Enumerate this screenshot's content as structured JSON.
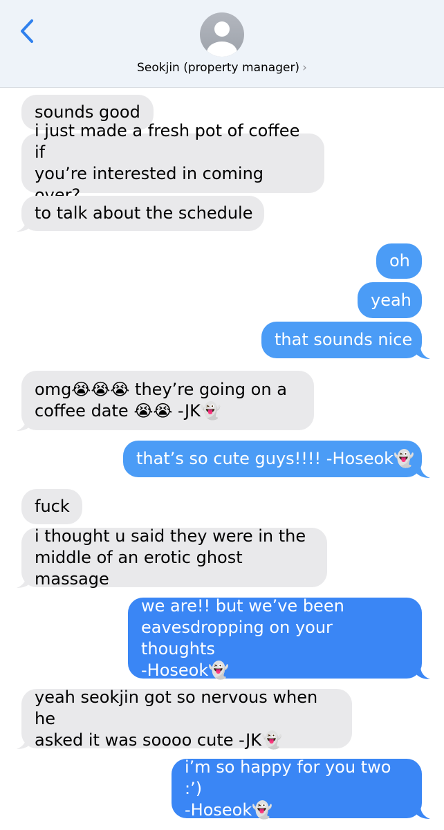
{
  "contact": {
    "name": "Seokjin (property manager)",
    "chevron": "›"
  },
  "messages": [
    {
      "side": "in",
      "text": "sounds good"
    },
    {
      "side": "in",
      "text": "i just made a fresh pot of coffee if\nyou’re interested in coming over?"
    },
    {
      "side": "in",
      "text": "to talk about the schedule"
    },
    {
      "side": "out",
      "text": "oh"
    },
    {
      "side": "out",
      "text": "yeah"
    },
    {
      "side": "out",
      "text": "that sounds nice"
    },
    {
      "side": "in",
      "text": "omg😭😭😭 they’re going on a\ncoffee date 😭😭 -JK👻"
    },
    {
      "side": "out",
      "text": "that’s so cute guys!!!! -Hoseok👻"
    },
    {
      "side": "in",
      "text": "fuck"
    },
    {
      "side": "in",
      "text": "i thought u said they were in the\nmiddle of an erotic ghost massage"
    },
    {
      "side": "out",
      "text": "we are!! but we’ve been\neavesdropping on your thoughts\n-Hoseok👻"
    },
    {
      "side": "in",
      "text": "yeah seokjin got so nervous when he\nasked it was soooo cute -JK👻"
    },
    {
      "side": "out",
      "text": "i’m so happy for you two :’)\n-Hoseok👻"
    }
  ],
  "colors": {
    "incoming": "#e9e9eb",
    "outgoing": "#4b9cf6",
    "link": "#2f80ed"
  },
  "icons": {
    "back": "chevron-left-icon",
    "avatar": "person-icon"
  }
}
